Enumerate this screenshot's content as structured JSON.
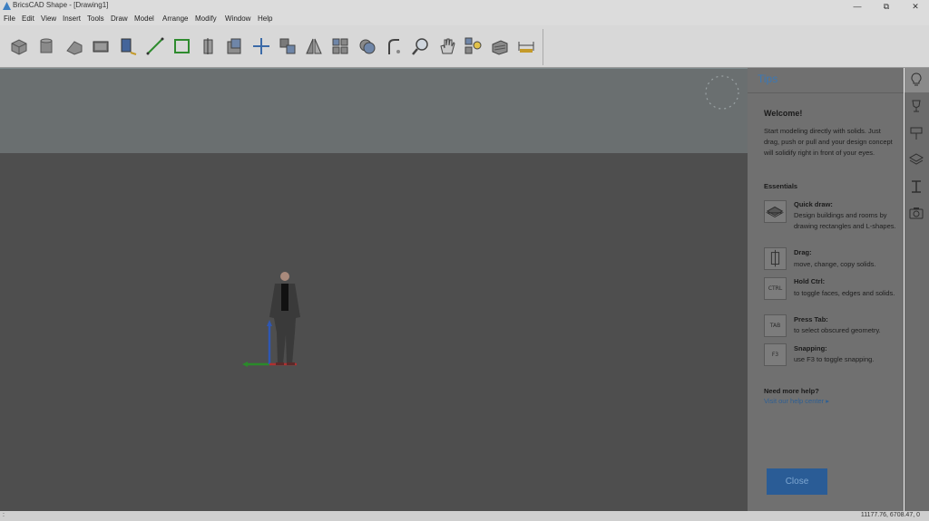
{
  "app": {
    "title": "BricsCAD Shape - [Drawing1]"
  },
  "window_controls": {
    "minimize": "—",
    "restore": "⧉",
    "close": "✕"
  },
  "menu": [
    "File",
    "Edit",
    "View",
    "Insert",
    "Tools",
    "Draw",
    "Model",
    "Arrange",
    "Modify",
    "Window",
    "Help"
  ],
  "toolbar": {
    "tools": [
      "box-icon",
      "cylinder-icon",
      "wedge-icon",
      "rectangle-icon",
      "polysolid-icon",
      "line-icon",
      "polyline-icon",
      "push-pull-icon",
      "extrude-icon",
      "move-icon",
      "copy-icon",
      "mirror-icon",
      "array-icon",
      "union-icon",
      "fillet-icon",
      "zoom-icon",
      "pan-icon",
      "lighting-icon",
      "material-icon",
      "dimension-icon"
    ]
  },
  "tips": {
    "title": "Tips",
    "welcome_heading": "Welcome!",
    "welcome_text": "Start modeling directly with solids. Just drag, push or pull and your design concept will solidify right in front of your eyes.",
    "essentials_heading": "Essentials",
    "essentials": [
      {
        "icon": "quick-draw-icon",
        "key": "",
        "title": "Quick draw:",
        "desc": "Design buildings and rooms by drawing rectangles and L-shapes."
      },
      {
        "icon": "drag-icon",
        "key": "",
        "title": "Drag:",
        "desc": "move, change, copy solids."
      },
      {
        "icon": "ctrl-key-icon",
        "key": "CTRL",
        "title": "Hold Ctrl:",
        "desc": "to toggle faces, edges and solids."
      },
      {
        "icon": "tab-key-icon",
        "key": "TAB",
        "title": "Press Tab:",
        "desc": "to select obscured geometry."
      },
      {
        "icon": "f3-key-icon",
        "key": "F3",
        "title": "Snapping:",
        "desc": "use F3 to toggle snapping."
      }
    ],
    "help_heading": "Need more help?",
    "help_link": "Visit our help center ▸",
    "close_label": "Close"
  },
  "side_strip": [
    "lightbulb-icon",
    "trophy-icon",
    "paint-roller-icon",
    "layers-icon",
    "beam-icon",
    "camera-icon"
  ],
  "status": {
    "command": ":",
    "coords": "11177.76, 6708.47, 0"
  }
}
